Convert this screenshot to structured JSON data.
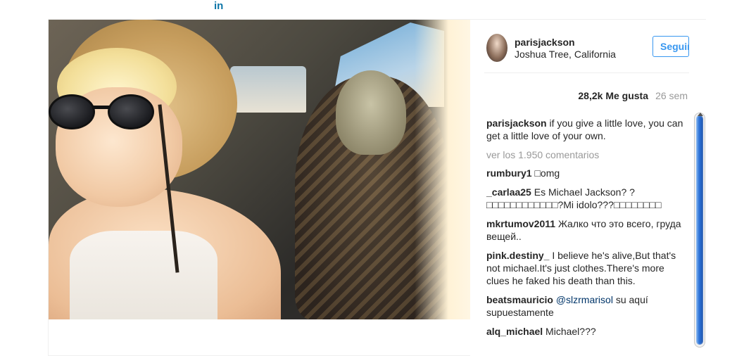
{
  "top": {
    "linkedin_icon": "in"
  },
  "post": {
    "photo_alt": "",
    "header": {
      "username": "parisjackson",
      "location": "Joshua Tree, California",
      "follow_label": "Seguir"
    },
    "stats": {
      "likes": "28,2k Me gusta",
      "time": "26 sem"
    },
    "caption": {
      "user": "parisjackson",
      "text": " if you give a little love, you can get a little love of your own."
    },
    "view_all": "ver los 1.950 comentarios",
    "comments": [
      {
        "user": "rumbury1",
        "text": " □omg"
      },
      {
        "user": "_carlaa25",
        "text": " Es Michael Jackson? ? □□□□□□□□□□□□?Mi idolo???□□□□□□□□"
      },
      {
        "user": "mkrtumov2011",
        "text": " Жалко что это всего, груда вещей.."
      },
      {
        "user": "pink.destiny_",
        "text": " I believe he's alive,But that's not michael.It's just clothes.There's more clues he faked his death than this."
      },
      {
        "user": "beatsmauricio",
        "mention": " @slzrmarisol",
        "text": " su aquí supuestamente"
      },
      {
        "user": "alq_michael",
        "text": " Michael???"
      }
    ]
  },
  "colors": {
    "accent": "#3897f0",
    "text": "#262626",
    "muted": "#999999",
    "linkedin": "#0e76a8"
  }
}
